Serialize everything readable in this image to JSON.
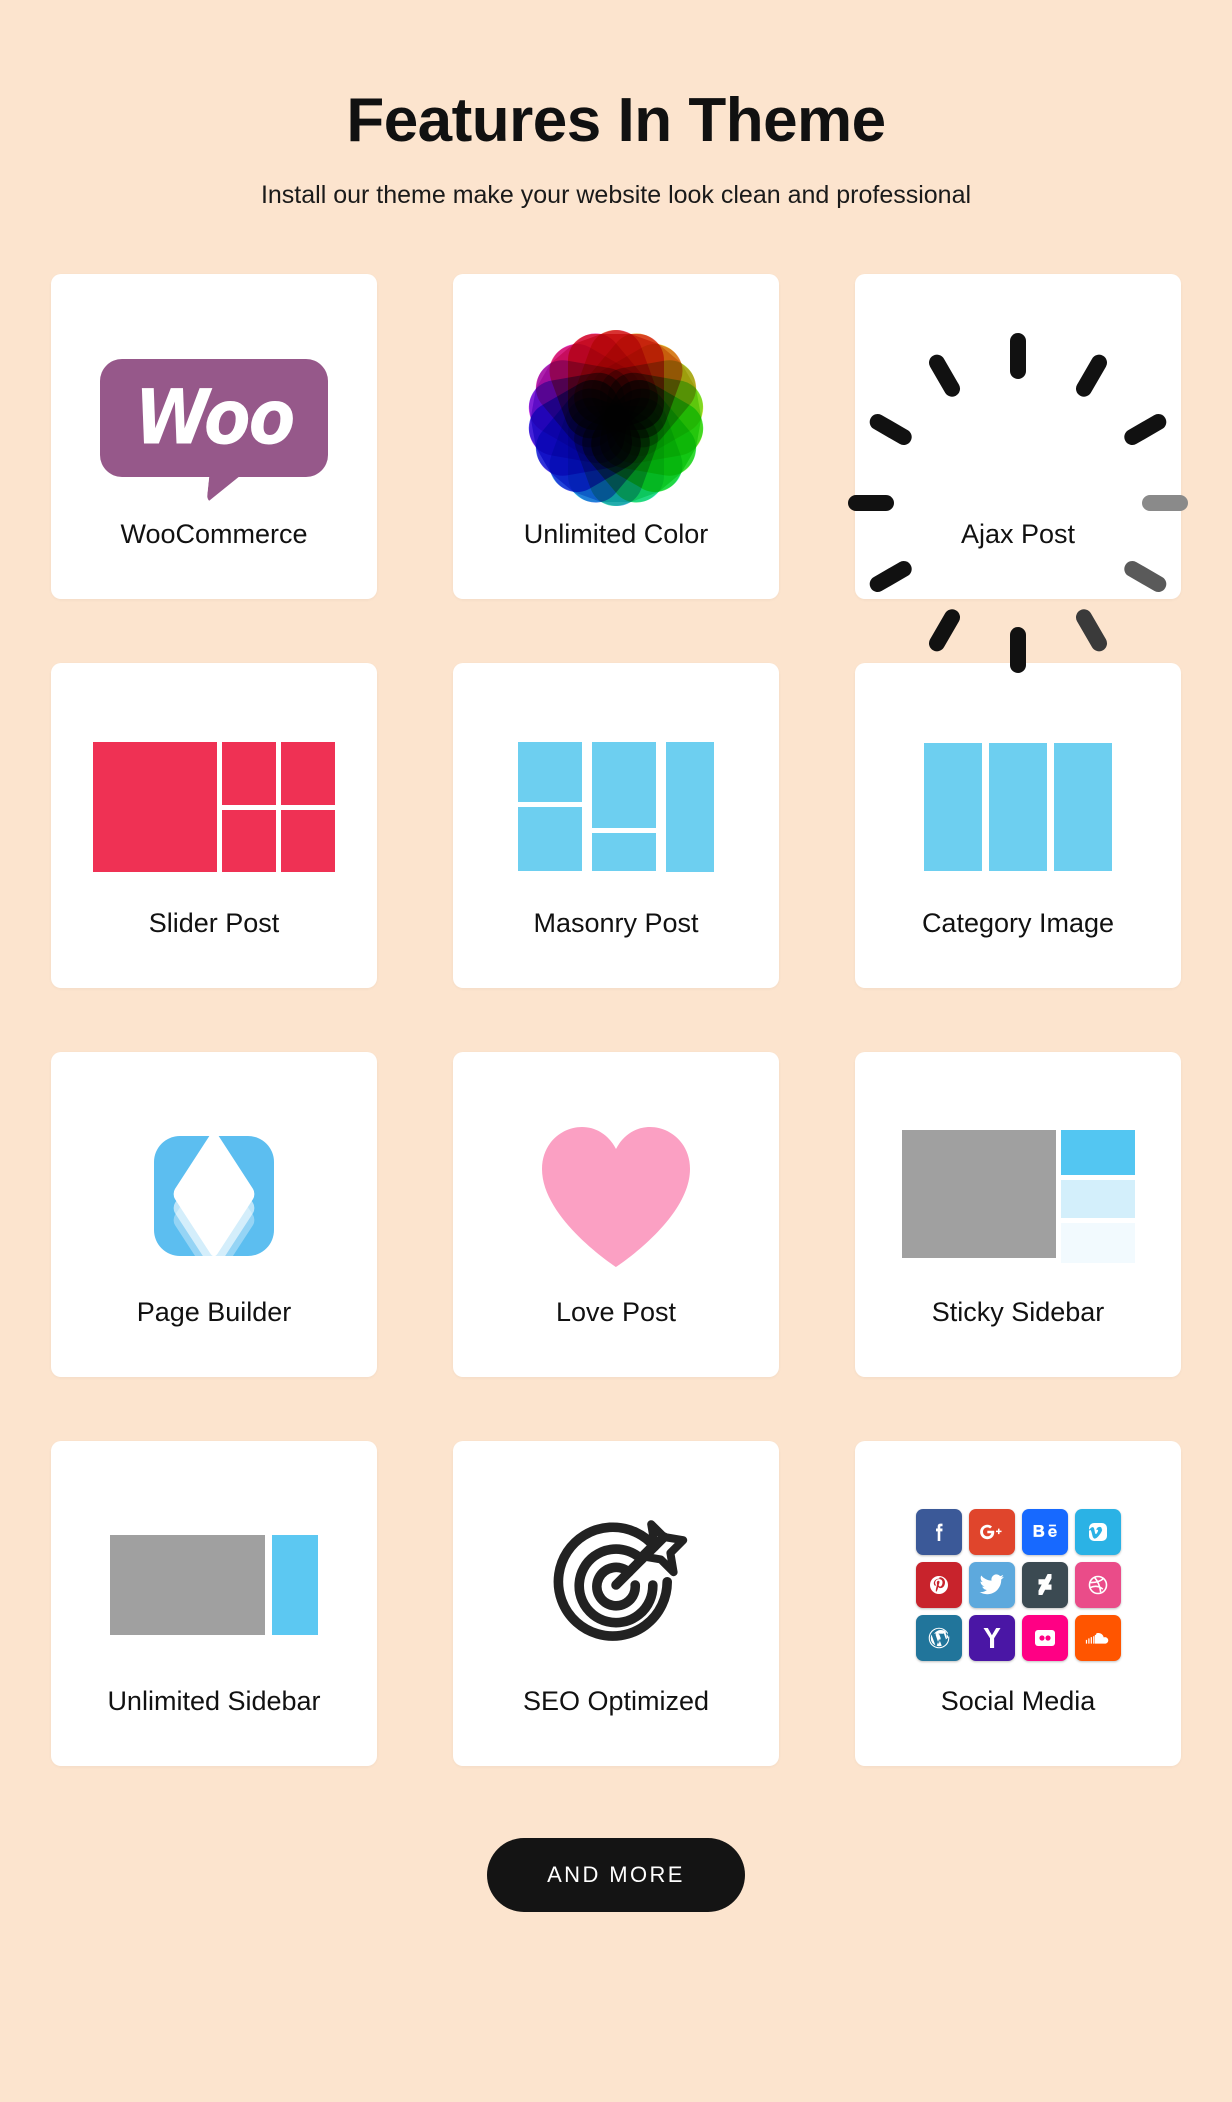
{
  "header": {
    "title": "Features In Theme",
    "subtitle": "Install our theme make your website look clean and professional"
  },
  "theme": {
    "background": "#FCE4CE",
    "card_background": "#FFFFFF",
    "accent_blue": "#6DCFF0",
    "accent_red": "#EF3154",
    "accent_purple": "#96588A",
    "accent_pink": "#FBA0C3",
    "accent_gray": "#A0A0A0",
    "button_background": "#141414",
    "text_color": "#111111"
  },
  "features": [
    {
      "label": "WooCommerce",
      "icon": "woocommerce-logo-icon"
    },
    {
      "label": "Unlimited Color",
      "icon": "color-wheel-icon"
    },
    {
      "label": "Ajax Post",
      "icon": "loading-spinner-icon"
    },
    {
      "label": "Slider Post",
      "icon": "slider-layout-icon"
    },
    {
      "label": "Masonry Post",
      "icon": "masonry-layout-icon"
    },
    {
      "label": "Category Image",
      "icon": "category-columns-icon"
    },
    {
      "label": "Page Builder",
      "icon": "layers-app-icon"
    },
    {
      "label": "Love Post",
      "icon": "heart-icon"
    },
    {
      "label": "Sticky Sidebar",
      "icon": "sticky-sidebar-layout-icon"
    },
    {
      "label": "Unlimited Sidebar",
      "icon": "sidebar-layout-icon"
    },
    {
      "label": "SEO Optimized",
      "icon": "target-arrow-icon"
    },
    {
      "label": "Social Media",
      "icon": "social-icons-grid-icon"
    }
  ],
  "woocommerce": {
    "wordmark": "Woo"
  },
  "social_icons": [
    {
      "name": "facebook",
      "glyph": "f",
      "color": "#3B5998"
    },
    {
      "name": "google-plus",
      "glyph": "G+",
      "color": "#E0452C"
    },
    {
      "name": "behance",
      "glyph": "Bē",
      "color": "#1769FF"
    },
    {
      "name": "vimeo",
      "glyph": "v",
      "color": "#2BB2E5"
    },
    {
      "name": "pinterest",
      "glyph": "P",
      "color": "#C8232C"
    },
    {
      "name": "twitter",
      "glyph": "t",
      "color": "#5DA9DD"
    },
    {
      "name": "deviantart",
      "glyph": "Ƶ",
      "color": "#3B4A52"
    },
    {
      "name": "dribbble",
      "glyph": "d",
      "color": "#EA4C89"
    },
    {
      "name": "wordpress",
      "glyph": "W",
      "color": "#21759B"
    },
    {
      "name": "yahoo",
      "glyph": "Y",
      "color": "#4A1majority"
    },
    {
      "name": "flickr",
      "glyph": "··",
      "color": "#FF0084"
    },
    {
      "name": "soundcloud",
      "glyph": "☁",
      "color": "#FF5500"
    }
  ],
  "footer": {
    "and_more_label": "AND MORE"
  }
}
